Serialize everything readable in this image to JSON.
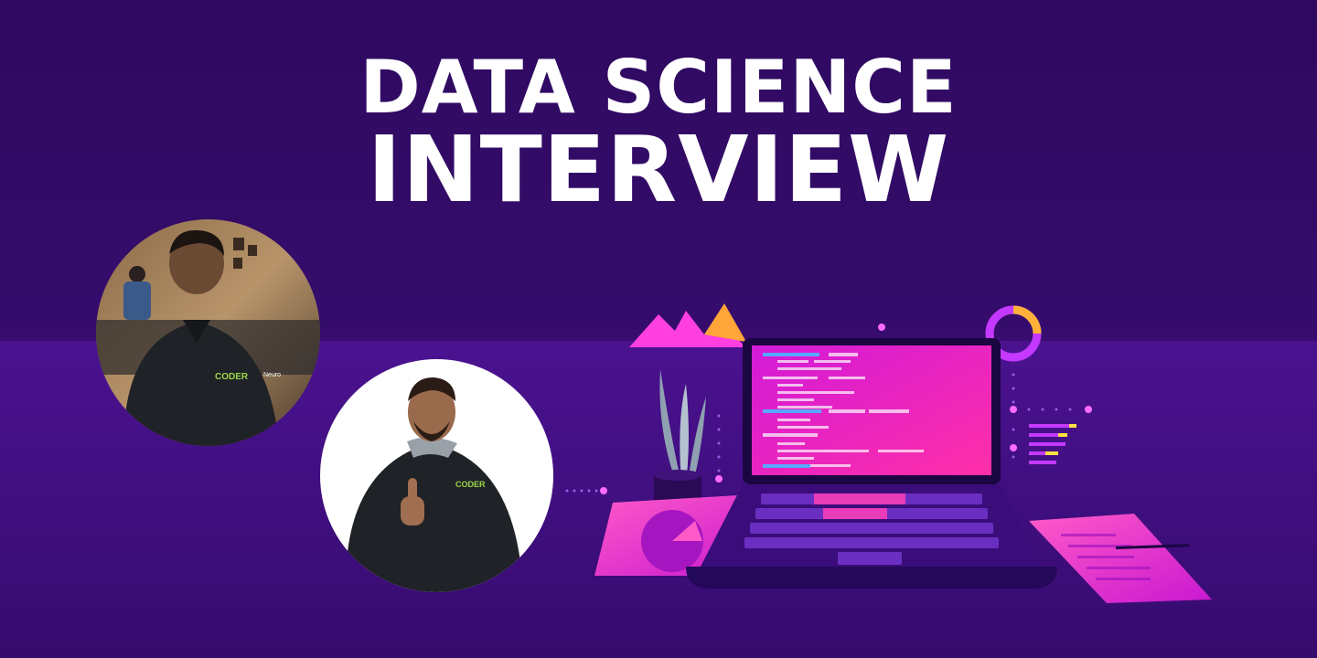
{
  "banner": {
    "title_line1": "DATA SCIENCE",
    "title_line2": "INTERVIEW"
  },
  "people": [
    {
      "shirt_text": "CODER",
      "extra_text": "Neuro"
    },
    {
      "shirt_text": "CODER"
    }
  ],
  "colors": {
    "background": "#2f0a60",
    "band": "#4b1290",
    "title": "#ffffff",
    "accent_pink": "#ff2fd0",
    "accent_orange": "#ff9a2e",
    "hoodie": "#1f2226",
    "logo_green": "#9bd64a"
  }
}
